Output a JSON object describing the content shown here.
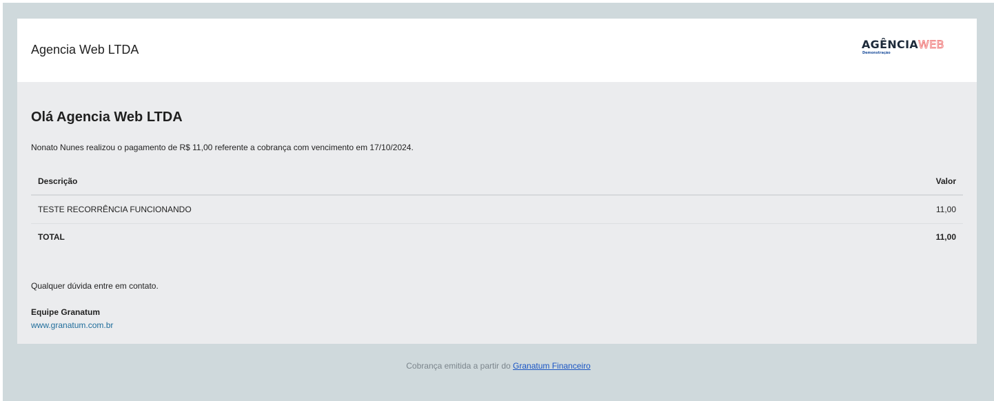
{
  "header": {
    "company_name": "Agencia Web LTDA",
    "logo": {
      "text_part1": "AGÊNCIA",
      "text_part2": "WEB",
      "subtitle": "Demonstração",
      "colors": {
        "primary": "#1d2a3a",
        "accent": "#f08080",
        "subtitle": "#1d4f9c"
      }
    }
  },
  "body": {
    "greeting": "Olá Agencia Web LTDA",
    "message": "Nonato Nunes realizou o pagamento de R$ 11,00 referente a cobrança com vencimento em 17/10/2024.",
    "table": {
      "columns": [
        "Descrição",
        "Valor"
      ],
      "rows": [
        {
          "description": "TESTE RECORRÊNCIA FUNCIONANDO",
          "value": "11,00"
        }
      ],
      "total": {
        "label": "TOTAL",
        "value": "11,00"
      }
    },
    "contact_text": "Qualquer dúvida entre em contato.",
    "signature": {
      "team": "Equipe Granatum",
      "link_text": "www.granatum.com.br"
    }
  },
  "footer": {
    "text": "Cobrança emitida a partir do ",
    "link_text": "Granatum Financeiro"
  },
  "colors": {
    "outer_background": "#cfd9dc",
    "body_background": "#ebecee",
    "link": "#1f6d9b",
    "footer_link": "#1a55c4"
  }
}
